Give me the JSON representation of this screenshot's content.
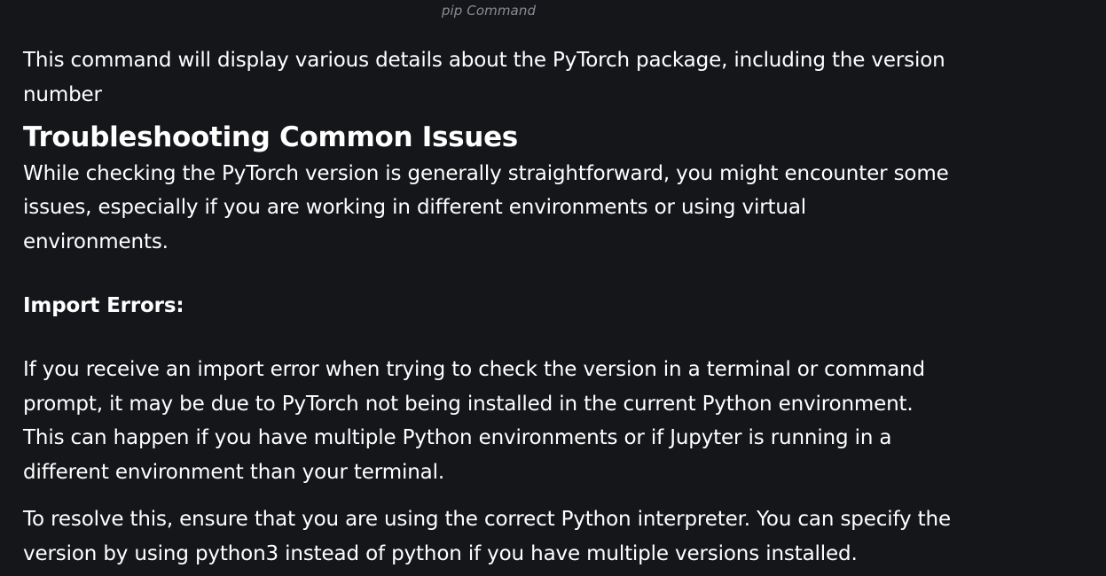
{
  "caption": "pip Command",
  "intro_paragraph": "This command will display various details about the PyTorch package, including the version number",
  "section": {
    "heading": "Troubleshooting Common Issues",
    "paragraph": "While checking the PyTorch version is generally straightforward, you might encounter some issues, especially if you are working in different environments or using virtual environments."
  },
  "import_errors": {
    "heading": "Import Errors:",
    "paragraph_1": "If you receive an import error when trying to check the version in a terminal or command prompt, it may be due to PyTorch not being installed in the current Python environment. This can happen if you have multiple Python environments or if Jupyter is running in a different environment than your terminal.",
    "paragraph_2": "To resolve this, ensure that you are using the correct Python interpreter. You can specify the version by using python3 instead of python if you have multiple versions installed."
  }
}
